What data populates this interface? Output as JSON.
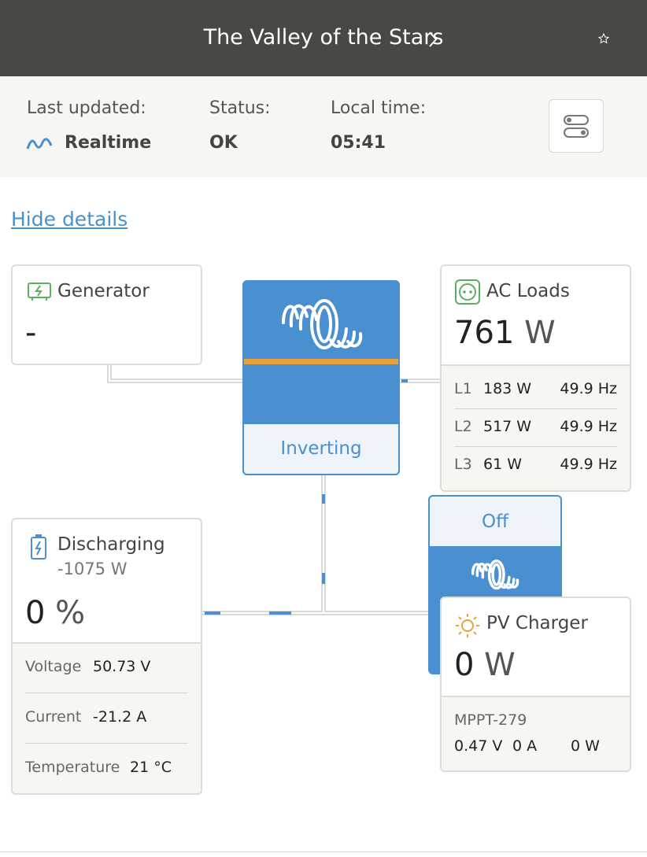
{
  "header": {
    "title": "The Valley of the Stars",
    "chevron_icon": "chevron-right-icon",
    "star_icon": "star-icon"
  },
  "status": {
    "last_updated_label": "Last updated:",
    "last_updated_value": "Realtime",
    "status_label": "Status:",
    "status_value": "OK",
    "local_time_label": "Local time:",
    "local_time_value": "05:41"
  },
  "hide_details": "Hide details",
  "generator": {
    "title": "Generator",
    "value": "-"
  },
  "inverter": {
    "state": "Inverting"
  },
  "ac_loads": {
    "title": "AC Loads",
    "value": "761",
    "unit": "W",
    "phases": [
      {
        "label": "L1",
        "power": "183 W",
        "freq": "49.9 Hz"
      },
      {
        "label": "L2",
        "power": "517 W",
        "freq": "49.9 Hz"
      },
      {
        "label": "L3",
        "power": "61 W",
        "freq": "49.9 Hz"
      }
    ]
  },
  "battery": {
    "title": "Discharging",
    "power": "-1075 W",
    "soc": "0",
    "soc_unit": "%",
    "rows": [
      {
        "label": "Voltage",
        "value": "50.73 V"
      },
      {
        "label": "Current",
        "value": "-21.2 A"
      },
      {
        "label": "Temperature",
        "value": "21 °C"
      }
    ]
  },
  "pv_box": {
    "state": "Off"
  },
  "pv_charger": {
    "title": "PV Charger",
    "value": "0",
    "unit": "W",
    "device": "MPPT-279",
    "voltage": "0.47 V",
    "current": "0 A",
    "power": "0 W"
  },
  "colors": {
    "header_bg": "#494843",
    "accent_blue": "#4a8fcf",
    "orange": "#e9a33c",
    "icon_green": "#5cae63"
  }
}
